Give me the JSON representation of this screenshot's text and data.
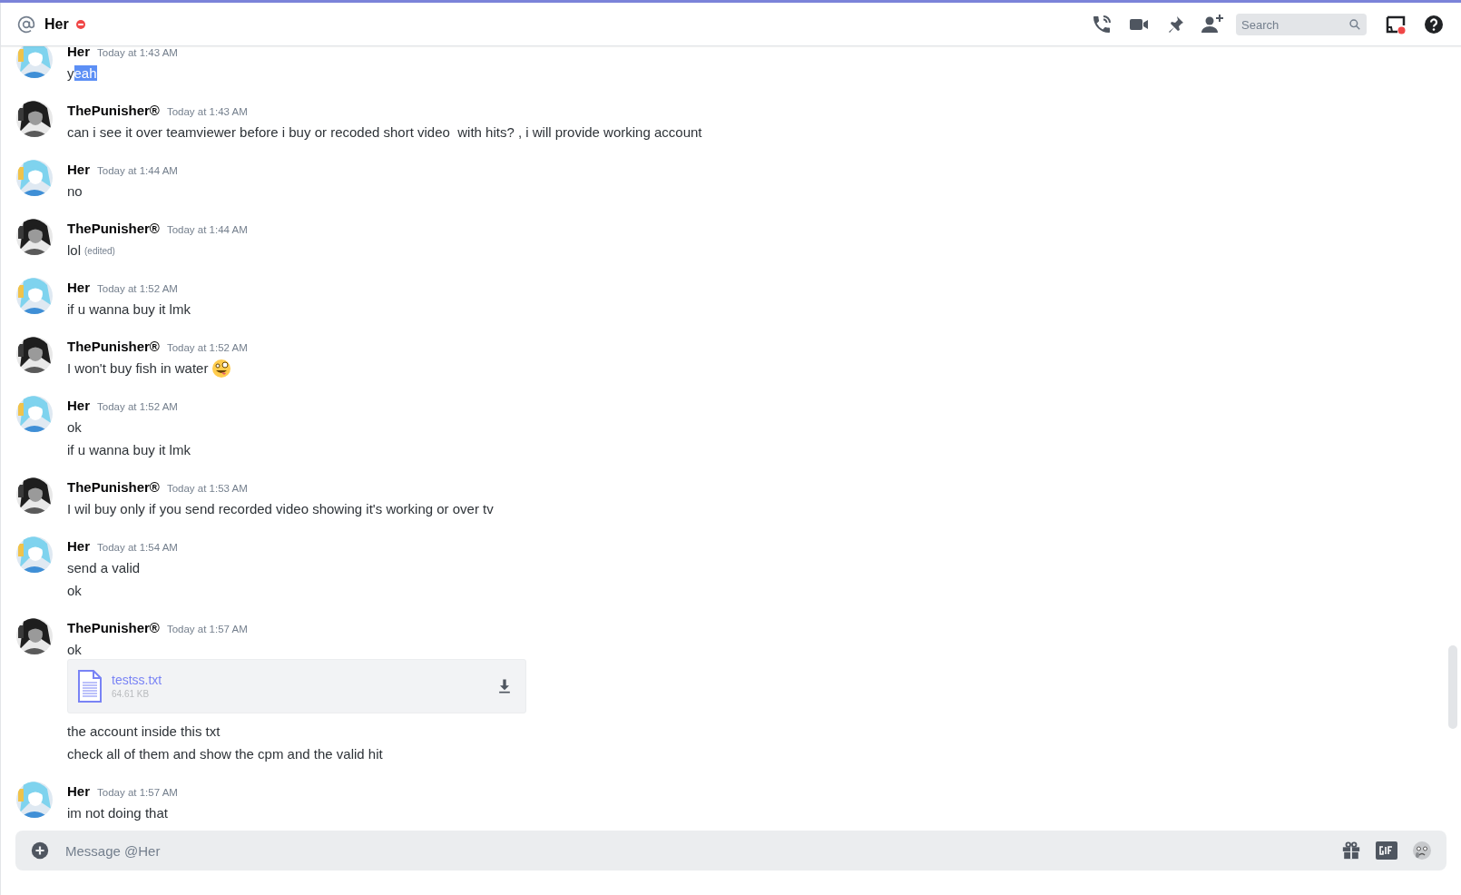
{
  "header": {
    "channel_name": "Her",
    "status": {
      "kind": "dnd"
    },
    "search": {
      "placeholder": "Search"
    }
  },
  "messages": [
    {
      "author": "Her",
      "avatar": {
        "kind": "blue"
      },
      "timestamp": "Today at 1:43 AM",
      "lines": [
        {
          "kind": "text",
          "segments": [
            {
              "text": "y",
              "selected": false
            },
            {
              "text": "eah",
              "selected": true
            }
          ]
        }
      ]
    },
    {
      "author": "ThePunisher®",
      "avatar": {
        "kind": "mono"
      },
      "timestamp": "Today at 1:43 AM",
      "lines": [
        {
          "kind": "text",
          "segments": [
            {
              "text": "can i see it over teamviewer before i buy or recoded short video  with hits? , i will provide working account",
              "selected": false
            }
          ]
        }
      ]
    },
    {
      "author": "Her",
      "avatar": {
        "kind": "blue"
      },
      "timestamp": "Today at 1:44 AM",
      "lines": [
        {
          "kind": "text",
          "segments": [
            {
              "text": "no",
              "selected": false
            }
          ]
        }
      ]
    },
    {
      "author": "ThePunisher®",
      "avatar": {
        "kind": "mono"
      },
      "timestamp": "Today at 1:44 AM",
      "lines": [
        {
          "kind": "text",
          "segments": [
            {
              "text": "lol",
              "selected": false
            }
          ],
          "edited": "(edited)"
        }
      ]
    },
    {
      "author": "Her",
      "avatar": {
        "kind": "blue"
      },
      "timestamp": "Today at 1:52 AM",
      "lines": [
        {
          "kind": "text",
          "segments": [
            {
              "text": "if u wanna buy it lmk",
              "selected": false
            }
          ]
        }
      ]
    },
    {
      "author": "ThePunisher®",
      "avatar": {
        "kind": "mono"
      },
      "timestamp": "Today at 1:52 AM",
      "lines": [
        {
          "kind": "text",
          "segments": [
            {
              "text": "I won't buy fish in water",
              "selected": false
            }
          ],
          "emoji": true
        }
      ]
    },
    {
      "author": "Her",
      "avatar": {
        "kind": "blue"
      },
      "timestamp": "Today at 1:52 AM",
      "lines": [
        {
          "kind": "text",
          "segments": [
            {
              "text": "ok",
              "selected": false
            }
          ]
        },
        {
          "kind": "text",
          "segments": [
            {
              "text": "if u wanna buy it lmk",
              "selected": false
            }
          ]
        }
      ]
    },
    {
      "author": "ThePunisher®",
      "avatar": {
        "kind": "mono"
      },
      "timestamp": "Today at 1:53 AM",
      "lines": [
        {
          "kind": "text",
          "segments": [
            {
              "text": "I wil buy only if you send recorded video showing it's working or over tv",
              "selected": false
            }
          ]
        }
      ]
    },
    {
      "author": "Her",
      "avatar": {
        "kind": "blue"
      },
      "timestamp": "Today at 1:54 AM",
      "lines": [
        {
          "kind": "text",
          "segments": [
            {
              "text": "send a valid",
              "selected": false
            }
          ]
        },
        {
          "kind": "text",
          "segments": [
            {
              "text": "ok",
              "selected": false
            }
          ]
        }
      ]
    },
    {
      "author": "ThePunisher®",
      "avatar": {
        "kind": "mono"
      },
      "timestamp": "Today at 1:57 AM",
      "lines": [
        {
          "kind": "text",
          "segments": [
            {
              "text": "ok",
              "selected": false
            }
          ]
        },
        {
          "kind": "attachment",
          "file_name": "testss.txt",
          "size": "64.61 KB"
        },
        {
          "kind": "text",
          "segments": [
            {
              "text": "the account inside this txt",
              "selected": false
            }
          ]
        },
        {
          "kind": "text",
          "segments": [
            {
              "text": "check all of them and show the cpm and the valid hit",
              "selected": false
            }
          ]
        }
      ]
    },
    {
      "author": "Her",
      "avatar": {
        "kind": "blue"
      },
      "timestamp": "Today at 1:57 AM",
      "lines": [
        {
          "kind": "text",
          "segments": [
            {
              "text": "im not doing that",
              "selected": false
            }
          ]
        }
      ]
    }
  ],
  "composer": {
    "placeholder": "Message @Her"
  }
}
